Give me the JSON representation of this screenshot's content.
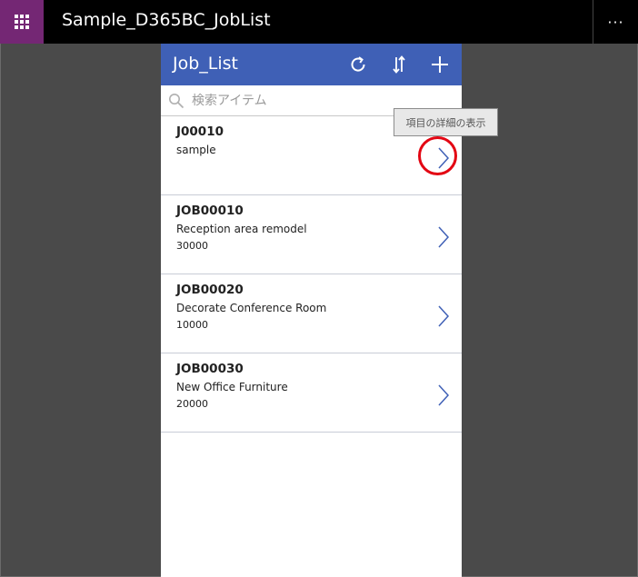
{
  "topbar": {
    "app_title": "Sample_D365BC_JobList",
    "more_label": "···",
    "accent_color": "#742774"
  },
  "screen": {
    "header_title": "Job_List",
    "header_color": "#3f60b6",
    "icons": [
      "refresh-icon",
      "sort-icon",
      "add-icon"
    ]
  },
  "search": {
    "placeholder": "検索アイテム",
    "value": ""
  },
  "items": [
    {
      "title": "J00010",
      "description": "sample",
      "amount": ""
    },
    {
      "title": "JOB00010",
      "description": "Reception area remodel",
      "amount": "30000"
    },
    {
      "title": "JOB00020",
      "description": "Decorate Conference Room",
      "amount": "10000"
    },
    {
      "title": "JOB00030",
      "description": "New Office Furniture",
      "amount": "20000"
    }
  ],
  "tooltip": {
    "text": "項目の詳細の表示"
  },
  "annotation": {
    "circle_color": "#e30613"
  }
}
